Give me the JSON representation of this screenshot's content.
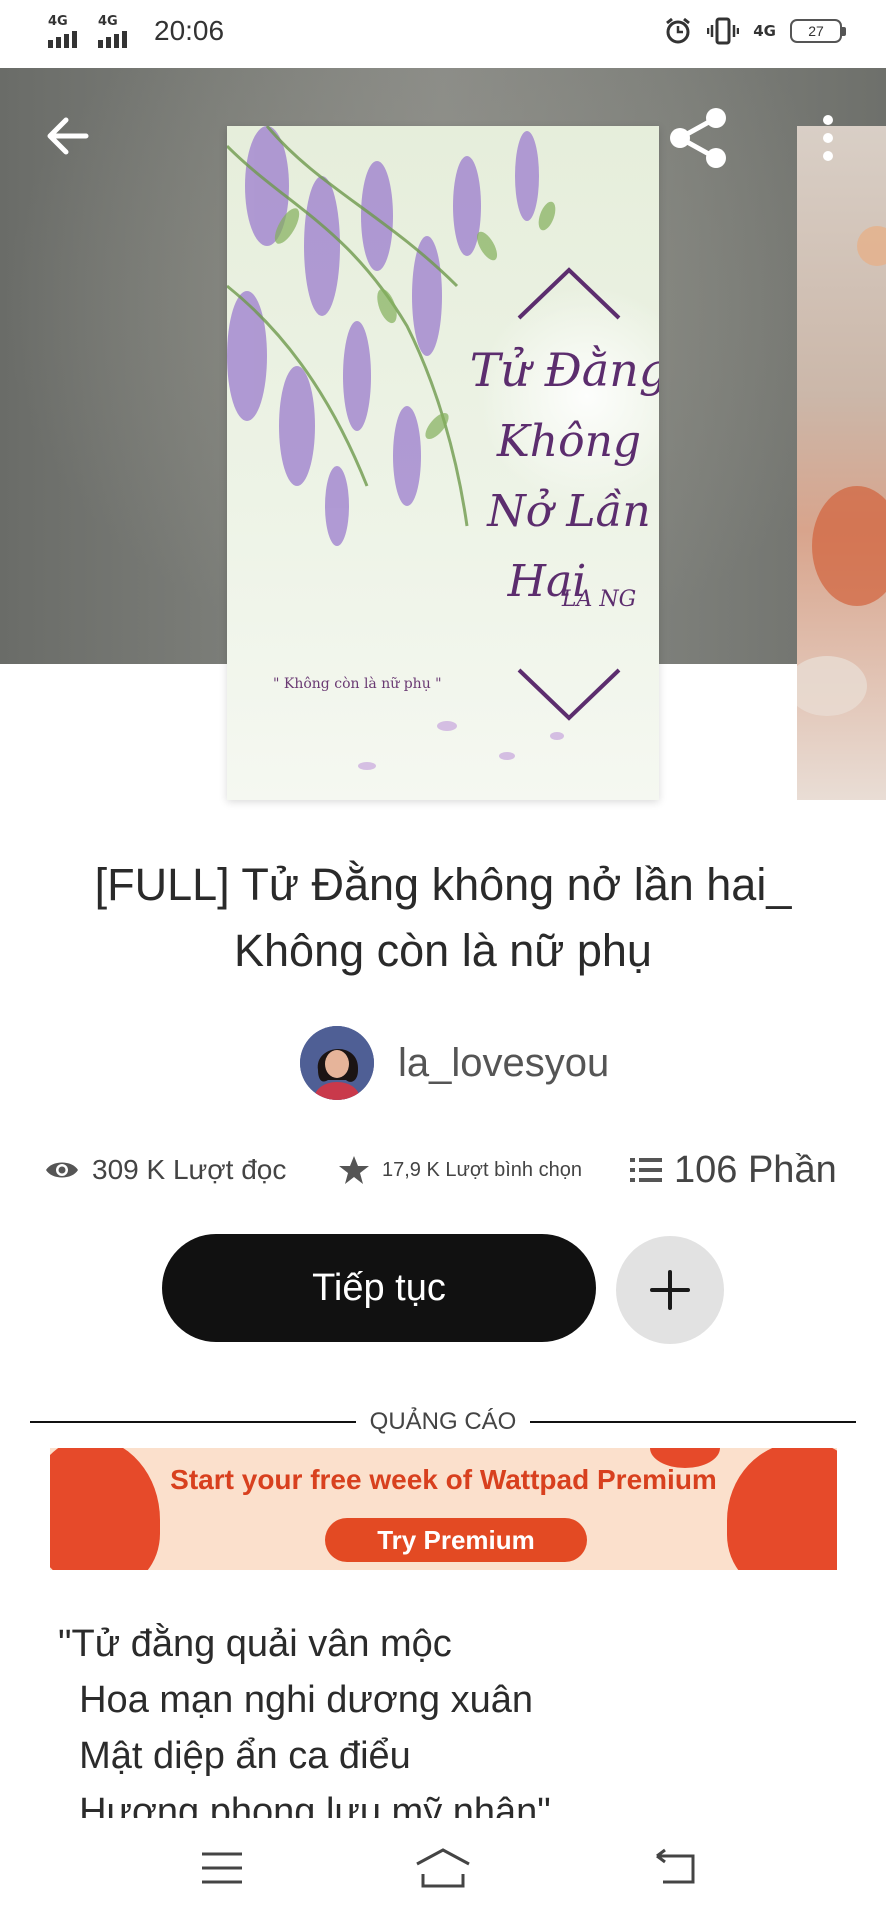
{
  "status_bar": {
    "signal_1": "4G",
    "signal_2": "4G",
    "time": "20:06",
    "network": "4G",
    "battery": "27"
  },
  "header": {
    "back_icon": "arrow-left-icon",
    "share_icon": "share-icon",
    "more_icon": "more-vertical-icon"
  },
  "cover": {
    "caption": "\" Không còn là nữ phụ \""
  },
  "story": {
    "title": "[FULL] Tử Đằng không nở lần hai_ Không còn là nữ phụ",
    "author": "la_lovesyou",
    "reads": "309 K Lượt đọc",
    "votes": "17,9 K Lượt bình chọn",
    "parts": "106 Phần"
  },
  "actions": {
    "continue_label": "Tiếp tục",
    "add_icon": "plus-icon"
  },
  "ad": {
    "section_label": "QUẢNG CÁO",
    "headline": "Start your free week of Wattpad Premium",
    "cta": "Try Premium",
    "colors": {
      "background": "#fbe0cc",
      "accent": "#e34a23"
    }
  },
  "description": {
    "lines": [
      "\"Tử đằng quải vân mộc",
      "  Hoa mạn nghi dương xuân",
      "  Mật diệp ẩn ca điểu",
      "  Hương phong lưu mỹ nhân\""
    ]
  },
  "nav": {
    "menu_icon": "menu-icon",
    "home_icon": "home-icon",
    "back_icon": "back-icon"
  }
}
